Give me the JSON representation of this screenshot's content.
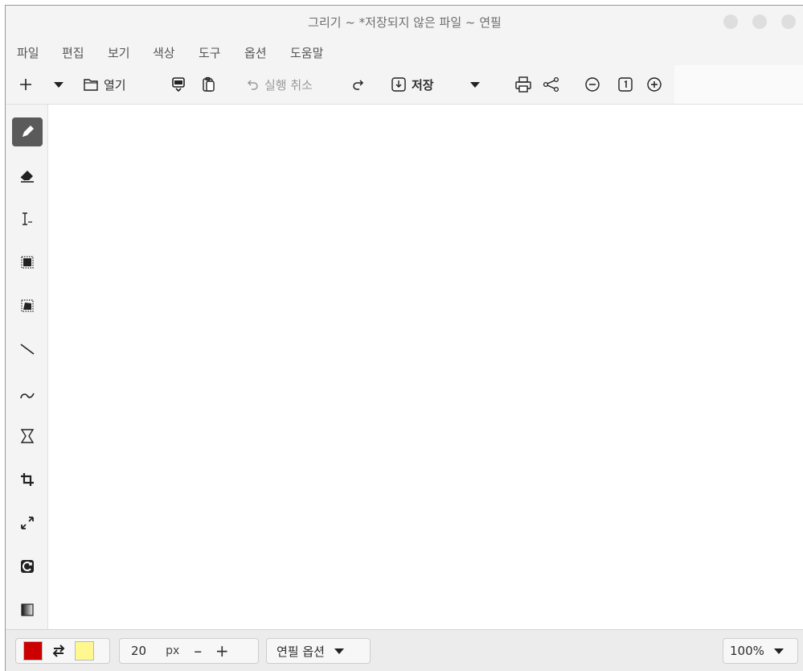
{
  "window": {
    "title": "그리기 ~ *저장되지 않은 파일 ~ 연필"
  },
  "menu": {
    "items": [
      "파일",
      "편집",
      "보기",
      "색상",
      "도구",
      "옵션",
      "도움말"
    ]
  },
  "toolbar": {
    "open_label": "열기",
    "undo_label": "실행 취소",
    "save_label": "저장"
  },
  "tools": [
    {
      "name": "pencil",
      "icon": "pencil-icon",
      "active": true
    },
    {
      "name": "eraser",
      "icon": "eraser-icon"
    },
    {
      "name": "text",
      "icon": "text-icon"
    },
    {
      "name": "rectangle-selection",
      "icon": "rect-select-icon"
    },
    {
      "name": "free-selection",
      "icon": "free-select-icon"
    },
    {
      "name": "line",
      "icon": "line-icon"
    },
    {
      "name": "curve",
      "icon": "curve-icon"
    },
    {
      "name": "shape",
      "icon": "shape-icon"
    },
    {
      "name": "crop",
      "icon": "crop-icon"
    },
    {
      "name": "scale",
      "icon": "scale-icon"
    },
    {
      "name": "rotate",
      "icon": "rotate-icon"
    },
    {
      "name": "filters",
      "icon": "filters-icon"
    }
  ],
  "colors": {
    "primary": "#cc0000",
    "secondary": "#fff78f"
  },
  "size": {
    "value": "20",
    "unit": "px",
    "decrease": "–",
    "increase": "+"
  },
  "options": {
    "label": "연필 옵션"
  },
  "zoom": {
    "label": "100%"
  }
}
